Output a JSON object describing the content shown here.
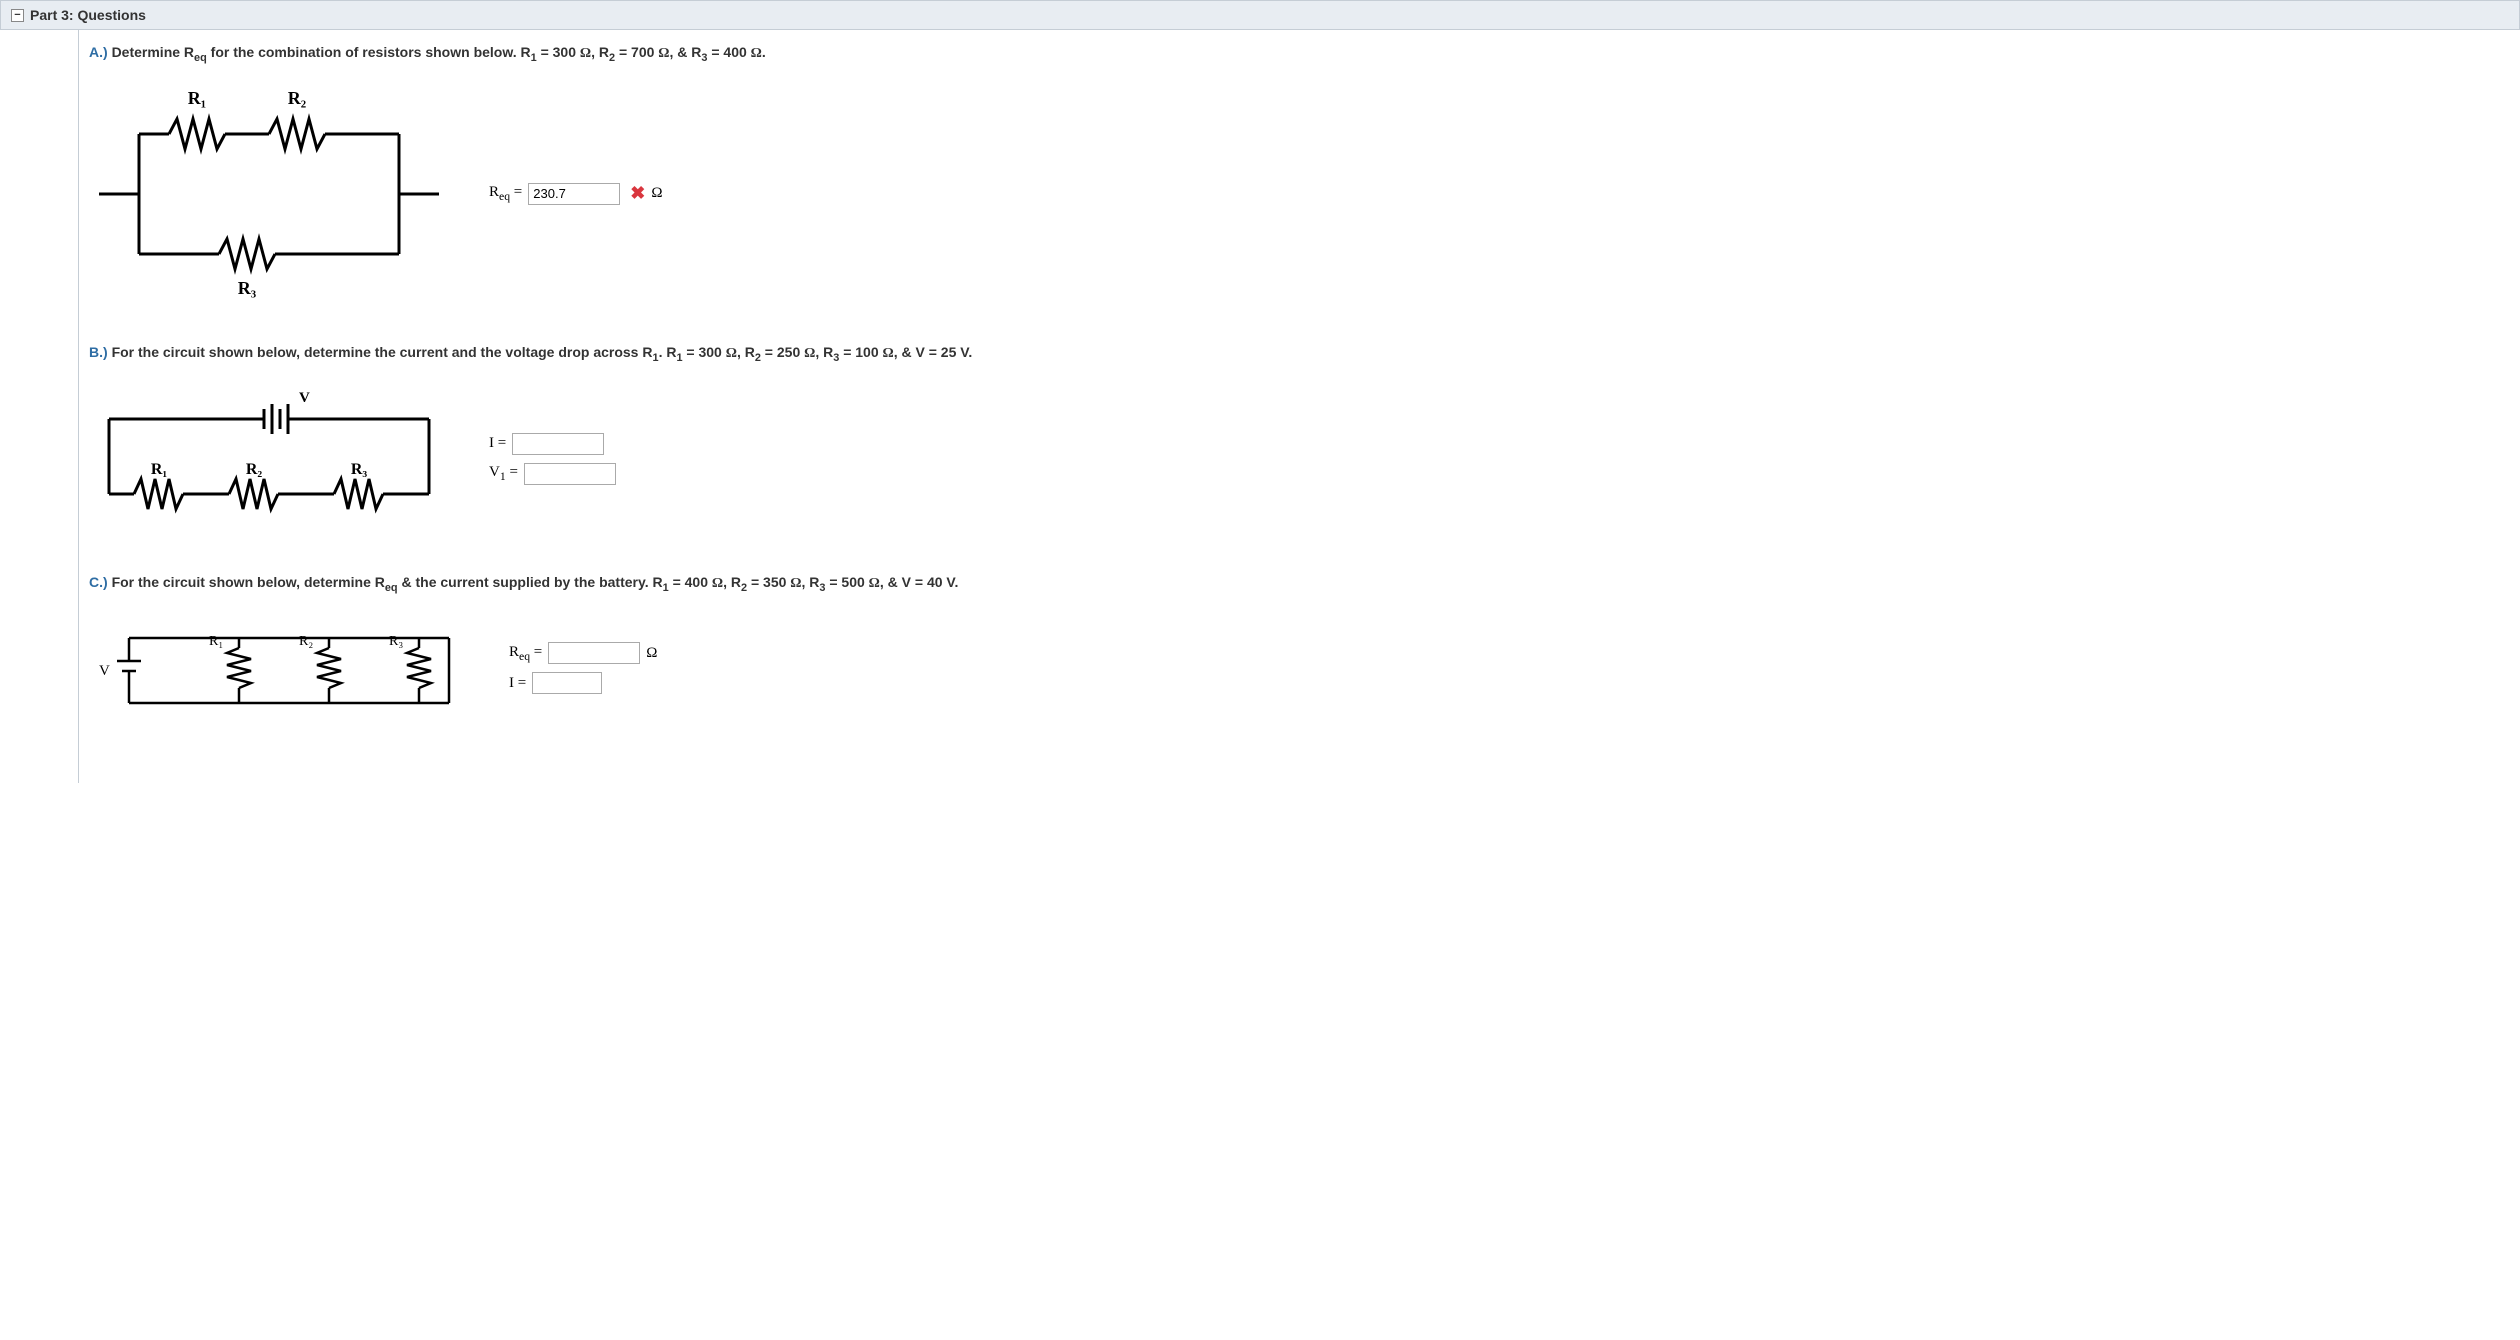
{
  "header": {
    "title": "Part 3: Questions",
    "collapse_glyph": "−"
  },
  "A": {
    "label": "A.)",
    "text_parts": {
      "p1": "Determine R",
      "sub_eq": "eq",
      "p2": " for the combination of resistors shown below. R",
      "s1": "1",
      "p3": " = 300 ",
      "om1": "Ω",
      "p4": ", R",
      "s2": "2",
      "p5": " = 700 ",
      "om2": "Ω",
      "p6": ", & R",
      "s3": "3",
      "p7": " = 400 ",
      "om3": "Ω",
      "p8": "."
    },
    "diagram": {
      "R1": "R₁",
      "R2": "R₂",
      "R3": "R₃"
    },
    "answer": {
      "label_pre": "R",
      "label_sub": "eq",
      "label_eq": " = ",
      "value": "230.7",
      "unit": "Ω",
      "incorrect": "✖"
    }
  },
  "B": {
    "label": "B.)",
    "text_parts": {
      "p1": "For the circuit shown below, determine the current and the voltage drop across R",
      "s0": "1",
      "p1b": ". R",
      "s1": "1",
      "p2": " = 300 ",
      "om1": "Ω",
      "p3": ", R",
      "s2": "2",
      "p4": " = 250 ",
      "om2": "Ω",
      "p5": ", R",
      "s3": "3",
      "p6": " = 100 ",
      "om3": "Ω",
      "p7": ", & V = 25 V."
    },
    "diagram": {
      "V": "V",
      "R1": "R₁",
      "R2": "R₂",
      "R3": "R₃"
    },
    "answers": {
      "I": {
        "label": "I = ",
        "value": ""
      },
      "V1": {
        "label_pre": "V",
        "label_sub": "1",
        "label_eq": " = ",
        "value": ""
      }
    }
  },
  "C": {
    "label": "C.)",
    "text_parts": {
      "p1": "For the circuit shown below, determine R",
      "sub_eq": "eq",
      "p2": " & the current supplied by the battery. R",
      "s1": "1",
      "p3": " = 400 ",
      "om1": "Ω",
      "p4": ", R",
      "s2": "2",
      "p5": " = 350 ",
      "om2": "Ω",
      "p6": ", R",
      "s3": "3",
      "p7": " = 500 ",
      "om3": "Ω",
      "p8": ", & V = 40 V."
    },
    "diagram": {
      "V": "V",
      "R1": "R₁",
      "R2": "R₂",
      "R3": "R₃"
    },
    "answers": {
      "Req": {
        "label_pre": "R",
        "label_sub": "eq",
        "label_eq": " = ",
        "value": "",
        "unit": "Ω"
      },
      "I": {
        "label": "I = ",
        "value": ""
      }
    }
  }
}
